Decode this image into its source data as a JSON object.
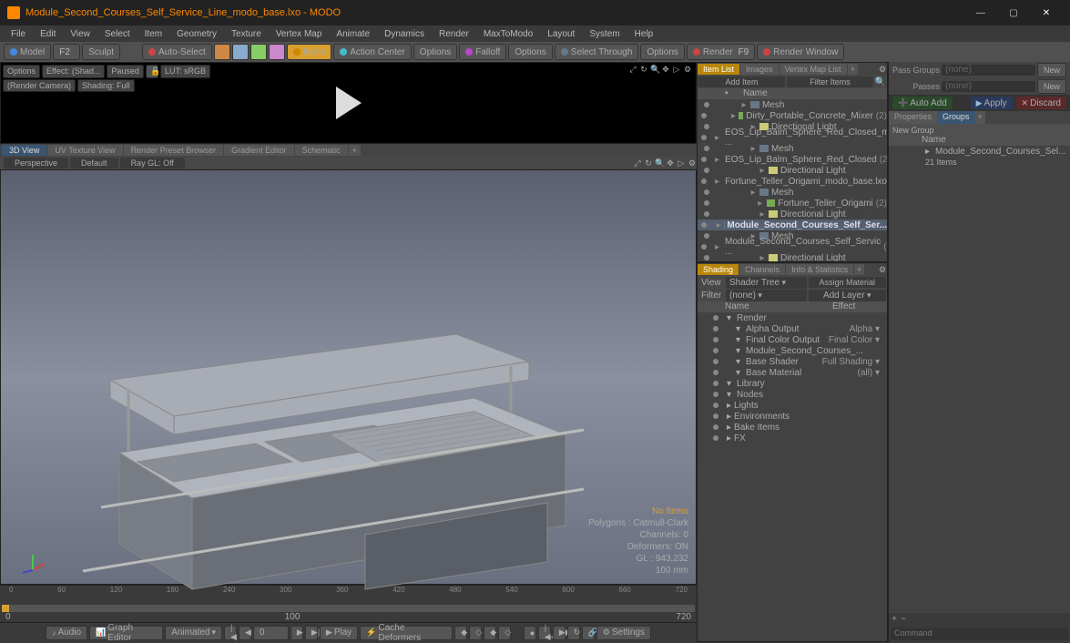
{
  "window": {
    "title": "Module_Second_Courses_Self_Service_Line_modo_base.lxo - MODO"
  },
  "menu": [
    "File",
    "Edit",
    "View",
    "Select",
    "Item",
    "Geometry",
    "Texture",
    "Vertex Map",
    "Animate",
    "Dynamics",
    "Render",
    "MaxToModo",
    "Layout",
    "System",
    "Help"
  ],
  "toolbar": {
    "model": "Model",
    "sculpt": "Sculpt",
    "autoselect": "Auto-Select",
    "items": "Items",
    "action": "Action Center",
    "options1": "Options",
    "falloff": "Falloff",
    "options2": "Options",
    "selthrough": "Select Through",
    "options3": "Options",
    "render": "Render",
    "renderwin": "Render Window"
  },
  "renderopts": {
    "options": "Options",
    "effect": "Effect: (Shad...",
    "paused": "Paused",
    "lut": "LUT: sRGB",
    "rcam": "(Render Camera)",
    "shading": "Shading: Full"
  },
  "viewtabs": [
    "3D View",
    "UV Texture View",
    "Render Preset Browser",
    "Gradient Editor",
    "Schematic"
  ],
  "viewopts": {
    "persp": "Perspective",
    "def": "Default",
    "ray": "Ray GL: Off"
  },
  "stats": {
    "noitems": "No Items",
    "poly": "Polygons : Catmull-Clark",
    "chan": "Channels: 0",
    "def": "Deformers: ON",
    "gl": "GL : 943,232",
    "mm": "100 mm"
  },
  "timeline": {
    "ticks": [
      "0",
      "60",
      "120",
      "180",
      "240",
      "300",
      "360",
      "420",
      "480",
      "540",
      "600",
      "660",
      "720"
    ],
    "start": "0",
    "end": "720",
    "cur": "100",
    "curR": "720"
  },
  "bottom": {
    "audio": "Audio",
    "graph": "Graph Editor",
    "anim": "Animated",
    "frame": "0",
    "play": "Play",
    "cache": "Cache Deformers",
    "settings": "Settings"
  },
  "itemlist": {
    "tabs": [
      "Item List",
      "Images",
      "Vertex Map List"
    ],
    "add": "Add Item",
    "filter": "Filter Items",
    "name": "Name",
    "items": [
      {
        "i": 1,
        "t": "grp",
        "l": "Mesh"
      },
      {
        "i": 2,
        "t": "mesh",
        "l": "Dirty_Portable_Concrete_Mixer",
        "n": "(2)"
      },
      {
        "i": 2,
        "t": "light",
        "l": "Directional Light"
      },
      {
        "i": 1,
        "t": "grp",
        "l": "EOS_Lip_Balm_Sphere_Red_Closed_mo ..."
      },
      {
        "i": 2,
        "t": "grp",
        "l": "Mesh"
      },
      {
        "i": 3,
        "t": "mesh",
        "l": "EOS_Lip_Balm_Sphere_Red_Closed",
        "n": "(2)"
      },
      {
        "i": 3,
        "t": "light",
        "l": "Directional Light"
      },
      {
        "i": 1,
        "t": "grp",
        "l": "Fortune_Teller_Origami_modo_base.lxo"
      },
      {
        "i": 2,
        "t": "grp",
        "l": "Mesh"
      },
      {
        "i": 3,
        "t": "mesh",
        "l": "Fortune_Teller_Origami",
        "n": "(2)"
      },
      {
        "i": 3,
        "t": "light",
        "l": "Directional Light"
      },
      {
        "i": 1,
        "t": "grp",
        "l": "Module_Second_Courses_Self_Ser...",
        "sel": true
      },
      {
        "i": 2,
        "t": "grp",
        "l": "Mesh"
      },
      {
        "i": 3,
        "t": "mesh",
        "l": "Module_Second_Courses_Self_Servic ...",
        "n": "(2)"
      },
      {
        "i": 3,
        "t": "light",
        "l": "Directional Light"
      }
    ]
  },
  "shading": {
    "tabs": [
      "Shading",
      "Channels",
      "Info & Statistics"
    ],
    "view": "View",
    "viewv": "Shader Tree",
    "assign": "Assign Material",
    "filter": "Filter",
    "filterv": "(none)",
    "addlayer": "Add Layer",
    "name": "Name",
    "effect": "Effect",
    "rows": [
      {
        "i": 0,
        "l": "Render",
        "e": ""
      },
      {
        "i": 1,
        "l": "Alpha Output",
        "e": "Alpha"
      },
      {
        "i": 1,
        "l": "Final Color Output",
        "e": "Final Color"
      },
      {
        "i": 1,
        "l": "Module_Second_Courses_...",
        "e": ""
      },
      {
        "i": 1,
        "l": "Base Shader",
        "e": "Full Shading"
      },
      {
        "i": 1,
        "l": "Base Material",
        "e": "(all)"
      },
      {
        "i": 0,
        "l": "Library",
        "e": ""
      },
      {
        "i": 0,
        "l": "Nodes",
        "e": ""
      },
      {
        "i": -1,
        "l": "Lights",
        "e": ""
      },
      {
        "i": -1,
        "l": "Environments",
        "e": ""
      },
      {
        "i": -1,
        "l": "Bake Items",
        "e": ""
      },
      {
        "i": -1,
        "l": "FX",
        "e": ""
      }
    ]
  },
  "passes": {
    "pg": "Pass Groups",
    "pgv": "(none)",
    "new1": "New",
    "p": "Passes",
    "pv": "(none)",
    "new2": "New"
  },
  "apply": {
    "auto": "Auto Add",
    "apply": "Apply",
    "discard": "Discard"
  },
  "groups": {
    "tabs": [
      "Properties",
      "Groups"
    ],
    "newgrp": "New Group",
    "name": "Name",
    "item": "Module_Second_Courses_Sel...",
    "cnt": "21 Items"
  },
  "cmd": "Command"
}
